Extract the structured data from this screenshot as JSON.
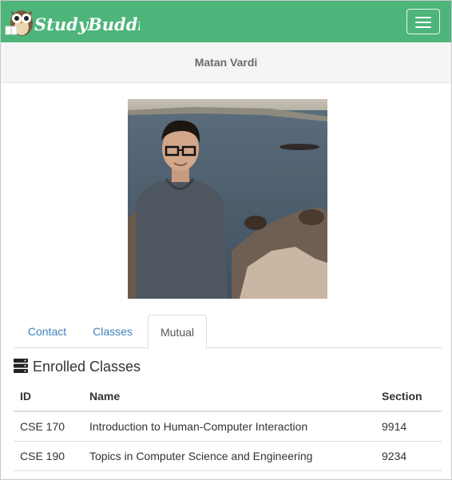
{
  "navbar": {
    "brand_text": "StudyBuddies",
    "brand_color": "#4db57a",
    "menu_icon": "hamburger-icon"
  },
  "profile": {
    "name": "Matan Vardi"
  },
  "tabs": [
    {
      "label": "Contact",
      "active": false
    },
    {
      "label": "Classes",
      "active": false
    },
    {
      "label": "Mutual",
      "active": true
    }
  ],
  "enrolled": {
    "title": "Enrolled Classes",
    "icon": "server-stack-icon",
    "headers": [
      "ID",
      "Name",
      "Section"
    ],
    "rows": [
      {
        "id": "CSE 170",
        "name": "Introduction to Human-Computer Interaction",
        "section": "9914"
      },
      {
        "id": "CSE 190",
        "name": "Topics in Computer Science and Engineering",
        "section": "9234"
      }
    ]
  },
  "colors": {
    "link": "#3f80bd",
    "subheader_bg": "#f5f5f5"
  }
}
